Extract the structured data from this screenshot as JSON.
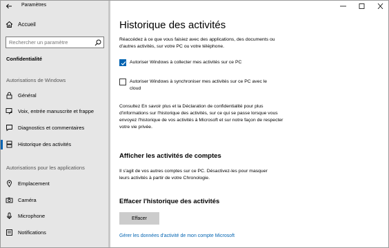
{
  "window": {
    "title": "Paramètres"
  },
  "sidebar": {
    "home_label": "Accueil",
    "search_placeholder": "Rechercher un paramètre",
    "current_section": "Confidentialité",
    "group1_title": "Autorisations de Windows",
    "group1_items": [
      {
        "label": "Général",
        "icon": "lock-icon"
      },
      {
        "label": "Voix, entrée manuscrite et frappe",
        "icon": "pen-icon"
      },
      {
        "label": "Diagnostics et commentaires",
        "icon": "feedback-icon"
      },
      {
        "label": "Historique des activités",
        "icon": "history-icon",
        "selected": true
      }
    ],
    "group2_title": "Autorisations pour les applications",
    "group2_items": [
      {
        "label": "Emplacement",
        "icon": "location-icon"
      },
      {
        "label": "Caméra",
        "icon": "camera-icon"
      },
      {
        "label": "Microphone",
        "icon": "microphone-icon"
      },
      {
        "label": "Notifications",
        "icon": "notifications-icon"
      }
    ]
  },
  "main": {
    "title": "Historique des activités",
    "description": "Réaccédez à ce que vous faisiez avec des applications, des documents ou d'autres activités, sur votre PC ou votre téléphone.",
    "checkbox_collect": {
      "label": "Autoriser Windows à collecter mes activités sur ce PC",
      "checked": true
    },
    "checkbox_sync": {
      "label": "Autoriser Windows à synchroniser mes activités sur ce PC avec le cloud",
      "checked": false
    },
    "info_text": "Consultez En savoir plus et la Déclaration de confidentialité pour plus d'informations sur l'historique des activités, sur ce qui se passe lorsque vous envoyez l'historique de vos activités à Microsoft et sur notre façon de respecter votre vie privée.",
    "accounts_heading": "Afficher les activités de comptes",
    "accounts_text": "Il s'agit de vos autres comptes sur ce PC. Désactivez-les pour masquer leurs activités à partir de votre Chronologie.",
    "clear_heading": "Effacer l'historique des activités",
    "clear_button": "Effacer",
    "manage_link": "Gérer les données d'activité de mon compte Microsoft"
  },
  "colors": {
    "accent": "#0063b1",
    "sidebar_bg": "#e6e6e6"
  }
}
